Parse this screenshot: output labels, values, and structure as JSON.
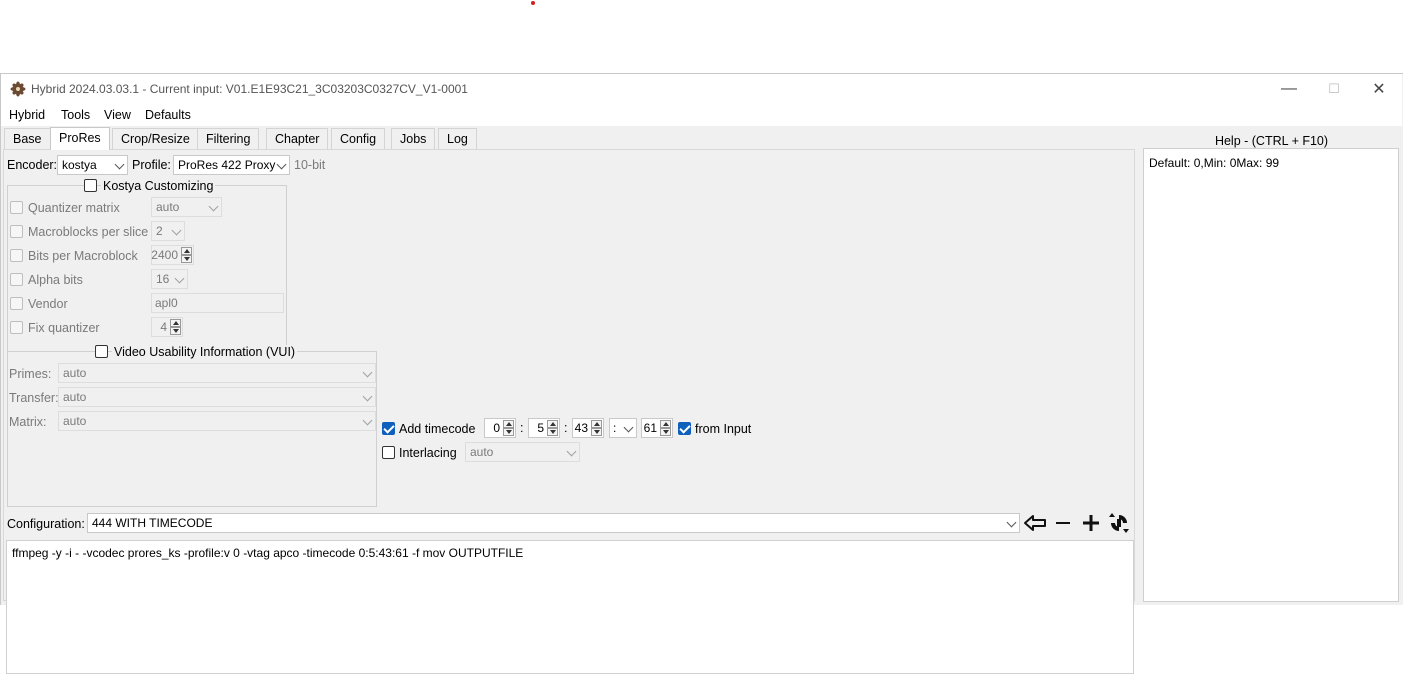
{
  "window": {
    "title": "Hybrid 2024.03.03.1 - Current input: V01.E1E93C21_3C03203C0327CV_V1-0001",
    "minimize": "—",
    "maximize": "☐",
    "close": "✕"
  },
  "menu": [
    "Hybrid",
    "Tools",
    "View",
    "Defaults"
  ],
  "tabs": [
    "Base",
    "ProRes",
    "Crop/Resize",
    "Filtering",
    "Chapter",
    "Config",
    "Jobs",
    "Log"
  ],
  "active_tab": "ProRes",
  "encoder": {
    "label": "Encoder:",
    "value": "kostya"
  },
  "profile": {
    "label": "Profile:",
    "value": "ProRes 422 Proxy",
    "bitdepth": "10-bit"
  },
  "kostya": {
    "title": "Kostya Customizing",
    "rows": [
      {
        "label": "Quantizer matrix",
        "value": "auto"
      },
      {
        "label": "Macroblocks per slice",
        "value": "2"
      },
      {
        "label": "Bits per Macroblock",
        "value": "2400"
      },
      {
        "label": "Alpha bits",
        "value": "16"
      },
      {
        "label": "Vendor",
        "value": "apl0"
      },
      {
        "label": "Fix quantizer",
        "value": "4"
      }
    ]
  },
  "vui": {
    "title": "Video Usability Information (VUI)",
    "primes": {
      "label": "Primes:",
      "value": "auto"
    },
    "transfer": {
      "label": "Transfer:",
      "value": "auto"
    },
    "matrix": {
      "label": "Matrix:",
      "value": "auto"
    }
  },
  "timecode": {
    "label": "Add timecode",
    "hours": "0",
    "minutes": "5",
    "seconds": "43",
    "separator": ":",
    "frames": "61",
    "from_input": "from Input"
  },
  "interlacing": {
    "label": "Interlacing",
    "value": "auto"
  },
  "configuration": {
    "label": "Configuration:",
    "value": "444 WITH TIMECODE"
  },
  "command": "ffmpeg -y -i - -vcodec prores_ks -profile:v 0 -vtag apco -timecode 0:5:43:61 -f mov OUTPUTFILE",
  "help": {
    "title": "Help - (CTRL + F10)",
    "text": "Default: 0,Min: 0Max: 99"
  },
  "colors": {
    "check_blue": "#0f5fbd",
    "window_bg": "#f0f0f0"
  }
}
